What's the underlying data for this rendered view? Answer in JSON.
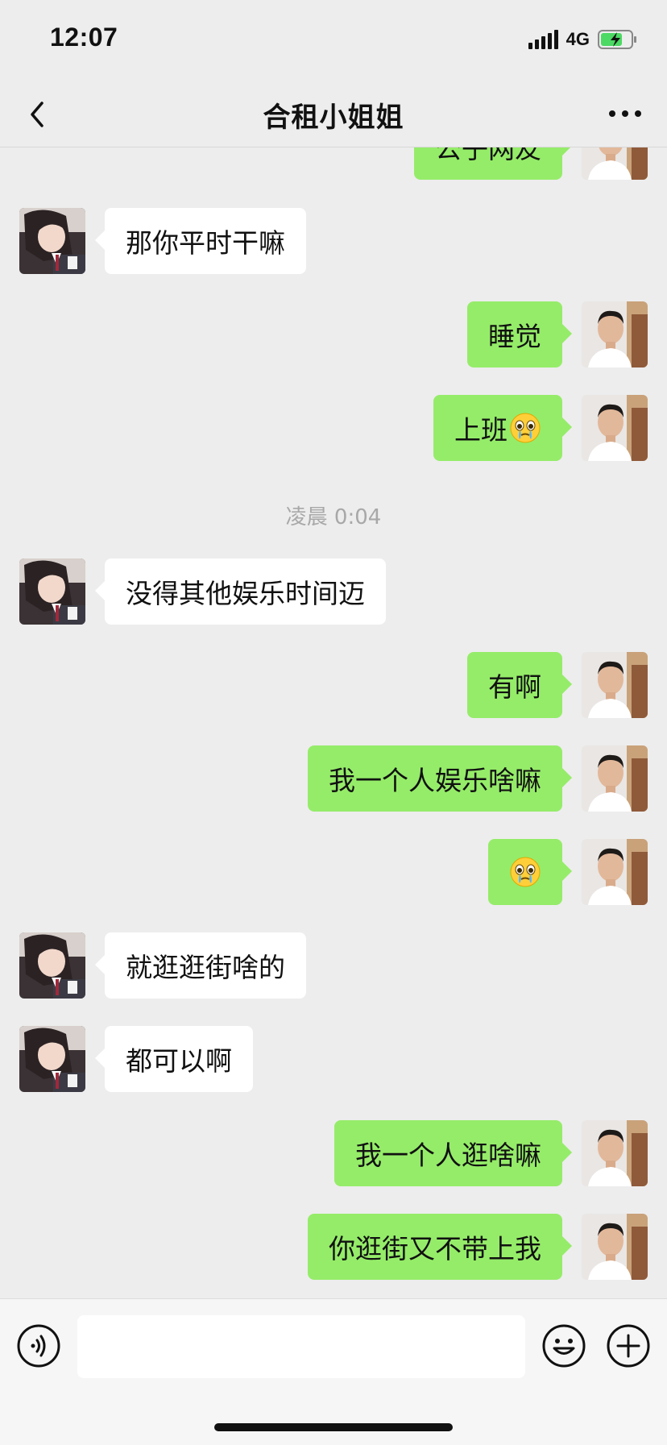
{
  "status_bar": {
    "time": "12:07",
    "network": "4G",
    "battery_state": "charging"
  },
  "header": {
    "title": "合租小姐姐",
    "back_icon": "chevron-left-icon",
    "more_icon": "more-dots-icon"
  },
  "colors": {
    "background": "#ededed",
    "bubble_self": "#95ec69",
    "bubble_other": "#ffffff",
    "timestamp": "#a8a8a8",
    "battery_charge": "#4cd964"
  },
  "messages": [
    {
      "sender": "me",
      "text": "公子网友",
      "partially_hidden": true
    },
    {
      "sender": "her",
      "text": "那你平时干嘛"
    },
    {
      "sender": "me",
      "text": "睡觉"
    },
    {
      "sender": "me",
      "text": "上班",
      "emoji": "teary-face-emoji"
    },
    {
      "type": "timestamp",
      "text": "凌晨 0:04"
    },
    {
      "sender": "her",
      "text": "没得其他娱乐时间迈"
    },
    {
      "sender": "me",
      "text": "有啊"
    },
    {
      "sender": "me",
      "text": "我一个人娱乐啥嘛"
    },
    {
      "sender": "me",
      "text": "",
      "emoji": "teary-face-emoji"
    },
    {
      "sender": "her",
      "text": "就逛逛街啥的"
    },
    {
      "sender": "her",
      "text": "都可以啊"
    },
    {
      "sender": "me",
      "text": "我一个人逛啥嘛"
    },
    {
      "sender": "me",
      "text": "你逛街又不带上我"
    }
  ],
  "input_bar": {
    "value": "",
    "voice_icon": "voice-icon",
    "emoji_icon": "emoji-icon",
    "plus_icon": "plus-icon"
  }
}
